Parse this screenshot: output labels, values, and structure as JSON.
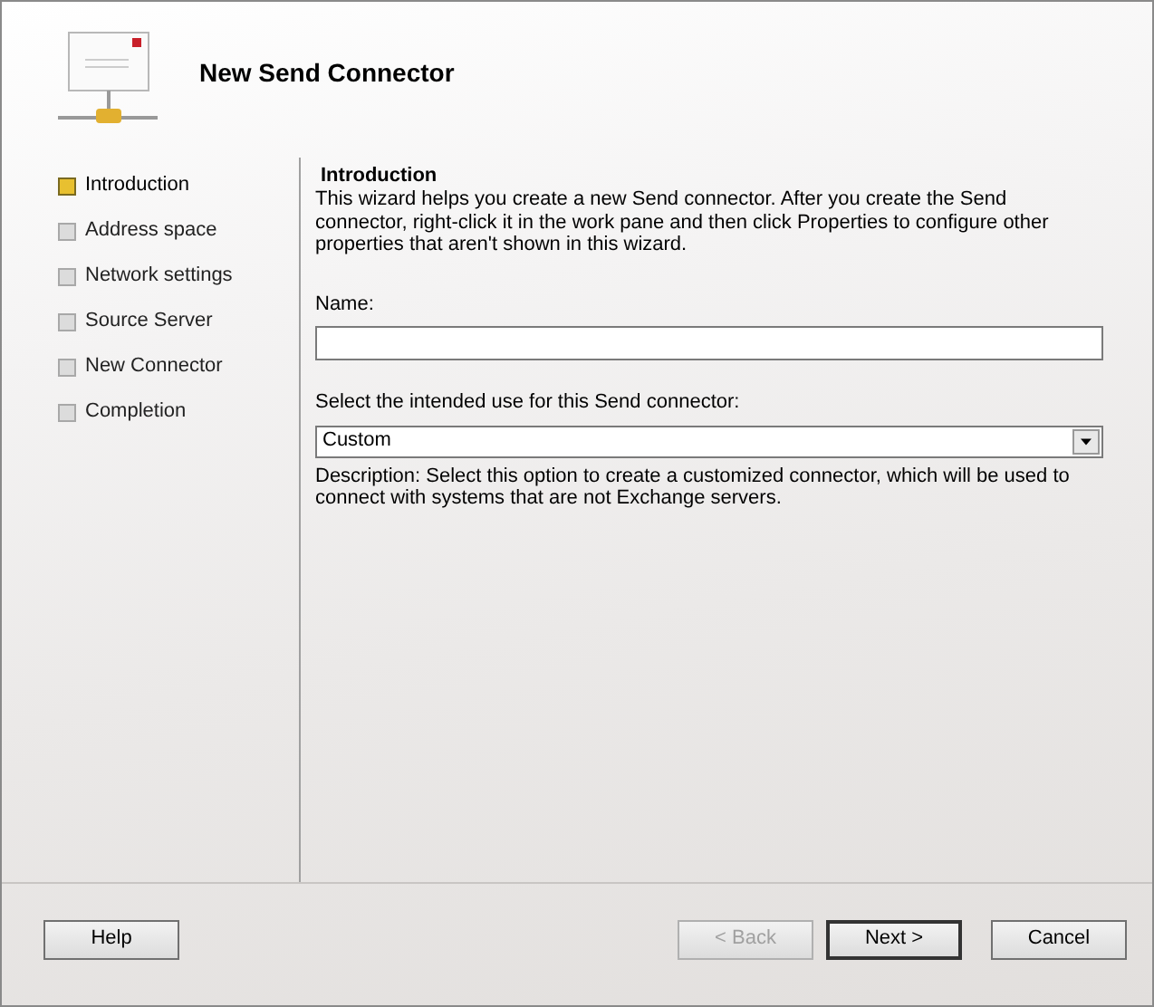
{
  "header": {
    "title": "New Send Connector"
  },
  "steps": [
    {
      "label": "Introduction",
      "selected": true
    },
    {
      "label": "Address space",
      "selected": false
    },
    {
      "label": "Network settings",
      "selected": false
    },
    {
      "label": "Source Server",
      "selected": false
    },
    {
      "label": "New Connector",
      "selected": false
    },
    {
      "label": "Completion",
      "selected": false
    }
  ],
  "page": {
    "heading": "Introduction",
    "intro": "This wizard helps you create a new Send connector. After you create the Send connector, right-click it in the work pane and then click Properties to configure other properties that aren't shown in this wizard.",
    "name_label": "Name:",
    "use_label": "Select the intended use for this Send connector:",
    "use_value": "Custom",
    "description": "Description: Select this option to create a customized connector, which will be used to connect with systems that are not Exchange servers."
  },
  "buttons": [
    {
      "label": "Help",
      "kind": "left",
      "disabled": false,
      "default": false
    },
    {
      "label": "< Back",
      "kind": "right",
      "disabled": true,
      "default": false
    },
    {
      "label": "Next >",
      "kind": "right",
      "disabled": false,
      "default": true
    },
    {
      "label": "Cancel",
      "kind": "right",
      "disabled": false,
      "default": false
    }
  ]
}
